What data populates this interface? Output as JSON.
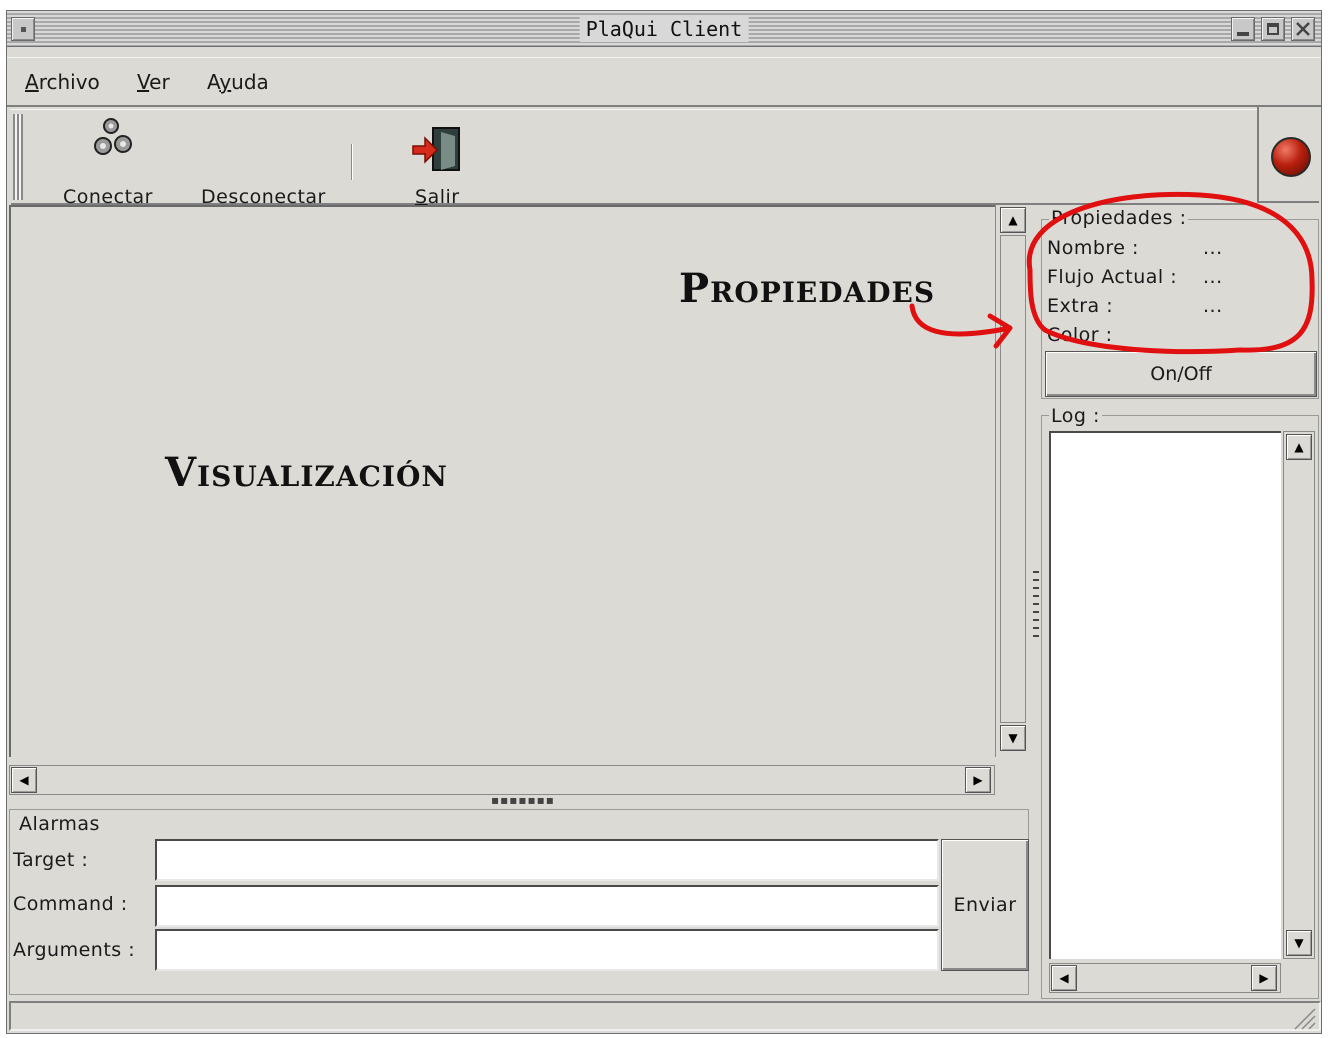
{
  "window": {
    "title": "PlaQui Client"
  },
  "menu": {
    "items": [
      {
        "mnemonic": "A",
        "rest": "rchivo"
      },
      {
        "mnemonic": "V",
        "rest": "er"
      },
      {
        "pre": "A",
        "mnemonic": "y",
        "rest": "uda"
      }
    ]
  },
  "toolbar": {
    "connect_label": "Conectar",
    "connect_icon": "gears-icon",
    "disconnect_label": "Desconectar",
    "exit_mnemonic": "S",
    "exit_rest": "alir",
    "exit_icon": "exit-door-icon",
    "status_light_color": "#b8200e"
  },
  "annotations": {
    "visualization": "Visualización",
    "properties": "Propiedades",
    "circle_color": "#e01010"
  },
  "properties": {
    "header": "Propiedades :",
    "rows": [
      {
        "label": "Nombre :",
        "value": "..."
      },
      {
        "label": "Flujo Actual :",
        "value": "..."
      },
      {
        "label": "Extra :",
        "value": "..."
      },
      {
        "label": "Color :",
        "value": ""
      }
    ],
    "toggle_label": "On/Off"
  },
  "log": {
    "header": "Log :"
  },
  "alarmas": {
    "header": "Alarmas",
    "target_label": "Target :",
    "target_value": "",
    "command_label": "Command :",
    "command_value": "",
    "arguments_label": "Arguments :",
    "arguments_value": "",
    "send_label": "Enviar"
  }
}
